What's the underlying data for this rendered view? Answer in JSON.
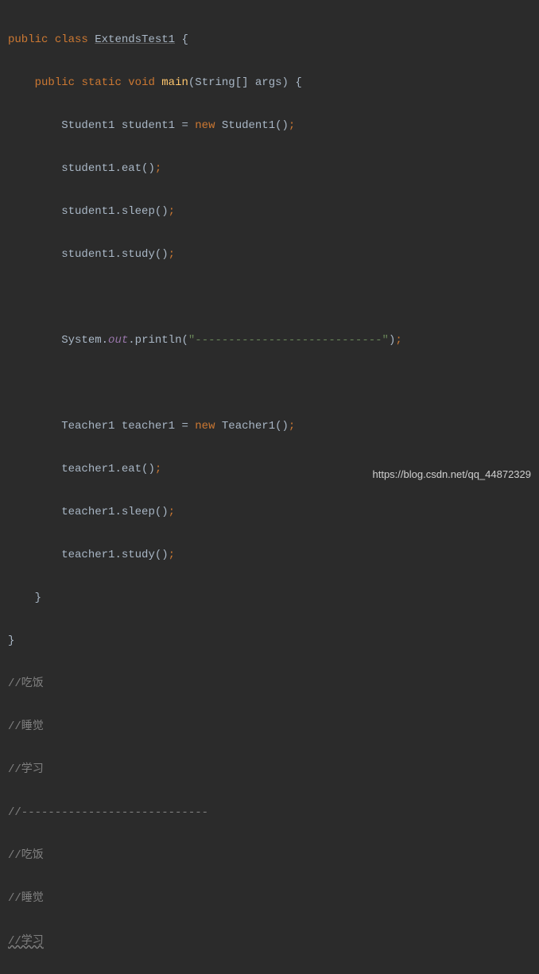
{
  "code": {
    "kw_public": "public",
    "kw_class": "class",
    "class_name": "ExtendsTest1",
    "brace_open": "{",
    "kw_static": "static",
    "kw_void": "void",
    "method_main": "main",
    "main_params_open": "(String[] args) ",
    "student_type": "Student1",
    "student_var": "student1",
    "equals": " = ",
    "kw_new": "new",
    "student_ctor": " Student1()",
    "call_eat": ".eat()",
    "call_sleep": ".sleep()",
    "call_study": ".study()",
    "system": "System",
    "dot": ".",
    "out": "out",
    "println": ".println(",
    "dash_string": "\"----------------------------\"",
    "println_close": ")",
    "teacher_type": "Teacher1",
    "teacher_var": "teacher1",
    "teacher_ctor": " Teacher1()",
    "brace_close_inner": "}",
    "brace_close_outer": "}",
    "semi": ";"
  },
  "comments": {
    "c1": "//吃饭",
    "c2": "//睡觉",
    "c3": "//学习",
    "c4": "//----------------------------",
    "c5": "//吃饭",
    "c6": "//睡觉",
    "c7": "//学习"
  },
  "watermark": "https://blog.csdn.net/qq_44872329"
}
